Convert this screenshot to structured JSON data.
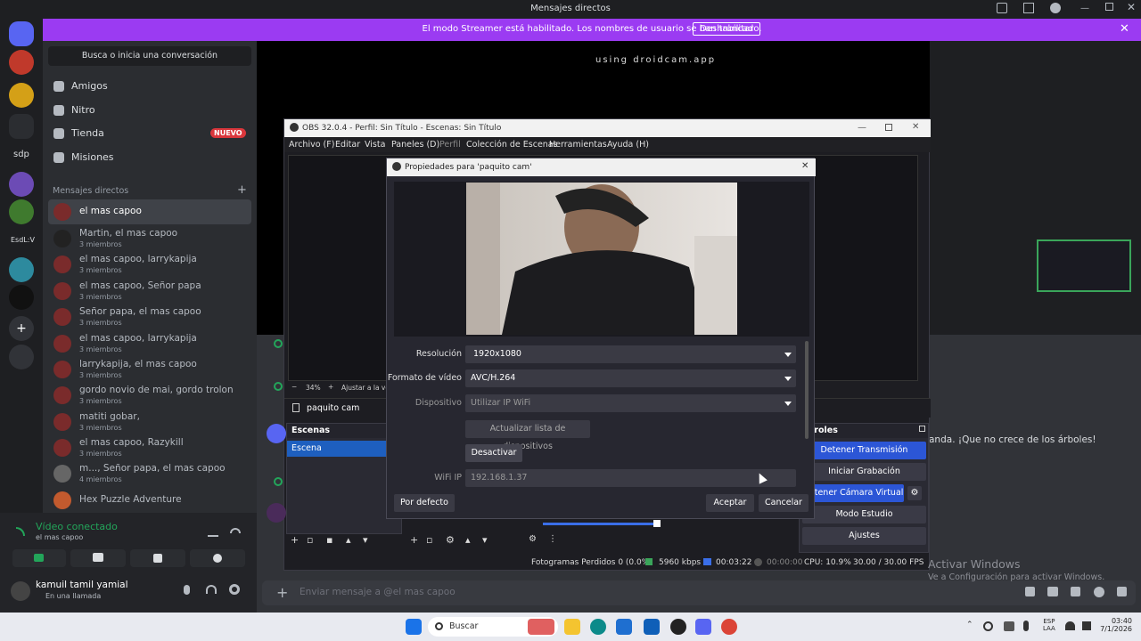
{
  "titlebar": {
    "title": "Mensajes directos"
  },
  "banner": {
    "message": "El modo Streamer está habilitado. Los nombres de usuario se han truncado.",
    "button": "Deshabilitar"
  },
  "rail": {
    "items": [
      "sdp",
      "EsdL:V"
    ]
  },
  "sidebar": {
    "search": "Busca o inicia una conversación",
    "nav": [
      "Amigos",
      "Nitro",
      "Tienda",
      "Misiones"
    ],
    "badge": "NUEVO",
    "dm_header": "Mensajes directos",
    "dms": [
      {
        "name": "el mas capoo",
        "sub": ""
      },
      {
        "name": "Martin, el mas capoo",
        "sub": "3 miembros"
      },
      {
        "name": "el mas capoo, larrykapija",
        "sub": "3 miembros"
      },
      {
        "name": "el mas capoo, Señor papa",
        "sub": "3 miembros"
      },
      {
        "name": "Señor papa, el mas capoo",
        "sub": "3 miembros"
      },
      {
        "name": "el mas capoo, larrykapija",
        "sub": "3 miembros"
      },
      {
        "name": "larrykapija, el mas capoo",
        "sub": "3 miembros"
      },
      {
        "name": "gordo novio de mai, gordo trolon",
        "sub": "3 miembros"
      },
      {
        "name": "matiti gobar,",
        "sub": "3 miembros"
      },
      {
        "name": "el mas capoo, Razykill",
        "sub": "3 miembros"
      },
      {
        "name": "m..., Señor papa, el mas capoo",
        "sub": "4 miembros"
      },
      {
        "name": "Hex Puzzle Adventure",
        "sub": ""
      }
    ]
  },
  "voice": {
    "status": "Vídeo conectado",
    "channel": "el mas capoo",
    "user": "kamuil tamil yamial",
    "user_status": "En una llamada"
  },
  "stream": {
    "watermark": "using droidcam.app"
  },
  "chat": {
    "snippet": "anda. ¡Que no crece de los árboles!",
    "placeholder": "Enviar mensaje a @el mas capoo"
  },
  "obs": {
    "title": "OBS 32.0.4 - Perfil: Sin Título - Escenas: Sin Título",
    "menu": [
      "Archivo (F)",
      "Editar",
      "Vista",
      "Paneles (D)",
      "Perfil",
      "Colección de Escenas",
      "Herramientas",
      "Ayuda (H)"
    ],
    "zoom": "34%",
    "zoom_label": "Ajustar a la ven",
    "source": "paquito cam",
    "scenes_header": "Escenas",
    "scene": "Escena",
    "controls_header": "ntroles",
    "controls": [
      "Detener Transmisión",
      "Iniciar Grabación",
      "Detener Cámara Virtual",
      "Modo Estudio",
      "Ajustes"
    ],
    "status": {
      "frames": "Fotogramas Perdidos 0 (0.0%)",
      "kbps": "5960 kbps",
      "time": "00:03:22",
      "rec": "00:00:00",
      "cpu": "CPU: 10.9%",
      "fps": "30.00 / 30.00 FPS"
    }
  },
  "dialog": {
    "title": "Propiedades para 'paquito cam'",
    "resolution_label": "Resolución",
    "resolution": "1920x1080",
    "format_label": "Formato de vídeo",
    "format": "AVC/H.264",
    "device_label": "Dispositivo",
    "device": "Utilizar IP WiFi",
    "refresh": "Actualizar lista de dispositivos",
    "deactivate": "Desactivar",
    "wifi_label": "WiFi IP",
    "wifi": "192.168.1.37",
    "defaults": "Por defecto",
    "ok": "Aceptar",
    "cancel": "Cancelar"
  },
  "watermark": {
    "title": "Activar Windows",
    "sub": "Ve a Configuración para activar Windows."
  },
  "taskbar": {
    "search": "Buscar",
    "lang1": "ESP",
    "lang2": "LAA",
    "time": "03:40",
    "date": "7/1/2026"
  }
}
